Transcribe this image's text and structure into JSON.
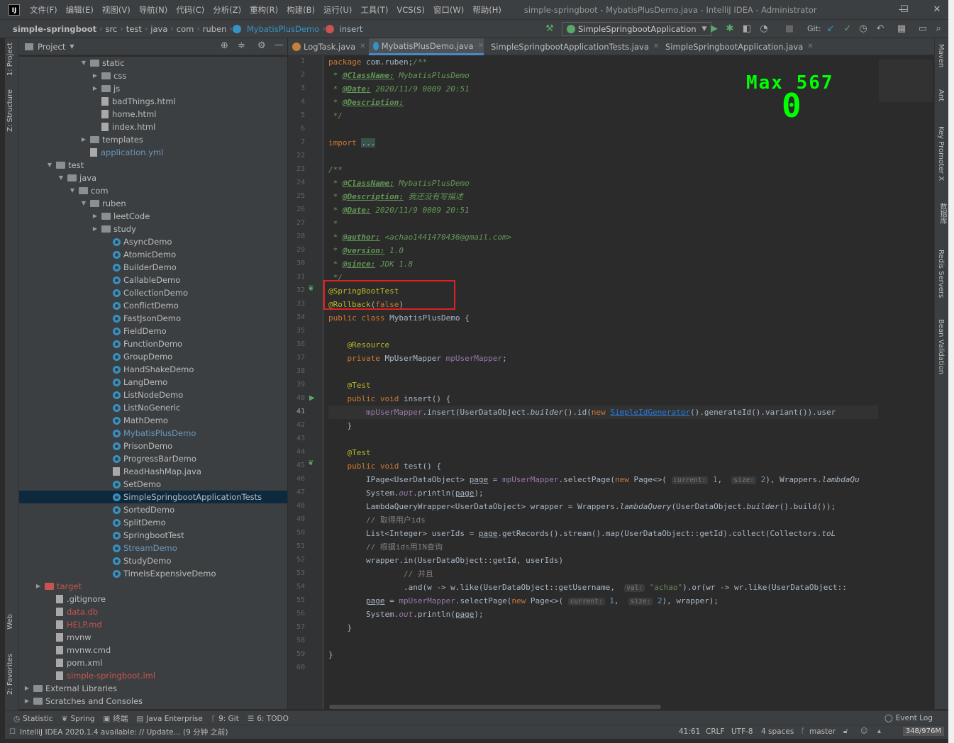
{
  "window": {
    "logo": "IJ",
    "title": "simple-springboot - MybatisPlusDemo.java - IntelliJ IDEA - Administrator",
    "menus": [
      "文件(F)",
      "编辑(E)",
      "视图(V)",
      "导航(N)",
      "代码(C)",
      "分析(Z)",
      "重构(R)",
      "构建(B)",
      "运行(U)",
      "工具(T)",
      "VCS(S)",
      "窗口(W)",
      "帮助(H)"
    ],
    "minimize": "—",
    "maximize": "☐",
    "close": "✕"
  },
  "breadcrumb": [
    "simple-springboot",
    "src",
    "test",
    "java",
    "com",
    "ruben",
    "MybatisPlusDemo",
    "insert"
  ],
  "toolbar": {
    "run_config": "SimpleSpringbootApplication",
    "git_label": "Git:"
  },
  "left_strip": {
    "project": "1: Project",
    "structure": "Z: Structure",
    "web": "Web",
    "favorites": "2: Favorites"
  },
  "right_strip": {
    "maven": "Maven",
    "ant": "Ant",
    "key_promoter": "Key Promoter X",
    "database": "数据库",
    "redis": "Redis Servers",
    "bean": "Bean Validation"
  },
  "project_panel": {
    "title": "Project"
  },
  "tree": [
    {
      "label": "static",
      "indent": 5,
      "type": "folder",
      "open": true
    },
    {
      "label": "css",
      "indent": 6,
      "type": "folder",
      "open": false
    },
    {
      "label": "js",
      "indent": 6,
      "type": "folder",
      "open": false
    },
    {
      "label": "badThings.html",
      "indent": 6,
      "type": "file"
    },
    {
      "label": "home.html",
      "indent": 6,
      "type": "file"
    },
    {
      "label": "index.html",
      "indent": 6,
      "type": "file"
    },
    {
      "label": "templates",
      "indent": 5,
      "type": "folder"
    },
    {
      "label": "application.yml",
      "indent": 5,
      "type": "file",
      "color": "blue"
    },
    {
      "label": "test",
      "indent": 2,
      "type": "folder",
      "open": true
    },
    {
      "label": "java",
      "indent": 3,
      "type": "folder",
      "open": true
    },
    {
      "label": "com",
      "indent": 4,
      "type": "folder",
      "open": true
    },
    {
      "label": "ruben",
      "indent": 5,
      "type": "folder",
      "open": true
    },
    {
      "label": "leetCode",
      "indent": 6,
      "type": "folder",
      "open": false
    },
    {
      "label": "study",
      "indent": 6,
      "type": "folder",
      "open": false
    },
    {
      "label": "AsyncDemo",
      "indent": 7,
      "type": "class"
    },
    {
      "label": "AtomicDemo",
      "indent": 7,
      "type": "class"
    },
    {
      "label": "BuilderDemo",
      "indent": 7,
      "type": "class"
    },
    {
      "label": "CallableDemo",
      "indent": 7,
      "type": "class"
    },
    {
      "label": "CollectionDemo",
      "indent": 7,
      "type": "class"
    },
    {
      "label": "ConflictDemo",
      "indent": 7,
      "type": "class"
    },
    {
      "label": "FastJsonDemo",
      "indent": 7,
      "type": "class"
    },
    {
      "label": "FieldDemo",
      "indent": 7,
      "type": "class"
    },
    {
      "label": "FunctionDemo",
      "indent": 7,
      "type": "class"
    },
    {
      "label": "GroupDemo",
      "indent": 7,
      "type": "class"
    },
    {
      "label": "HandShakeDemo",
      "indent": 7,
      "type": "class"
    },
    {
      "label": "LangDemo",
      "indent": 7,
      "type": "class"
    },
    {
      "label": "ListNodeDemo",
      "indent": 7,
      "type": "class"
    },
    {
      "label": "ListNoGeneric",
      "indent": 7,
      "type": "class"
    },
    {
      "label": "MathDemo",
      "indent": 7,
      "type": "class"
    },
    {
      "label": "MybatisPlusDemo",
      "indent": 7,
      "type": "class",
      "color": "blue"
    },
    {
      "label": "PrisonDemo",
      "indent": 7,
      "type": "class"
    },
    {
      "label": "ProgressBarDemo",
      "indent": 7,
      "type": "class"
    },
    {
      "label": "ReadHashMap.java",
      "indent": 7,
      "type": "file"
    },
    {
      "label": "SetDemo",
      "indent": 7,
      "type": "class"
    },
    {
      "label": "SimpleSpringbootApplicationTests",
      "indent": 7,
      "type": "class",
      "selected": true
    },
    {
      "label": "SortedDemo",
      "indent": 7,
      "type": "class"
    },
    {
      "label": "SplitDemo",
      "indent": 7,
      "type": "class"
    },
    {
      "label": "SpringbootTest",
      "indent": 7,
      "type": "class"
    },
    {
      "label": "StreamDemo",
      "indent": 7,
      "type": "class",
      "color": "blue"
    },
    {
      "label": "StudyDemo",
      "indent": 7,
      "type": "class"
    },
    {
      "label": "TimeIsExpensiveDemo",
      "indent": 7,
      "type": "class"
    },
    {
      "label": "target",
      "indent": 1,
      "type": "folder",
      "open": false,
      "color": "red"
    },
    {
      "label": ".gitignore",
      "indent": 2,
      "type": "file"
    },
    {
      "label": "data.db",
      "indent": 2,
      "type": "file",
      "color": "red"
    },
    {
      "label": "HELP.md",
      "indent": 2,
      "type": "file",
      "color": "red"
    },
    {
      "label": "mvnw",
      "indent": 2,
      "type": "file"
    },
    {
      "label": "mvnw.cmd",
      "indent": 2,
      "type": "file"
    },
    {
      "label": "pom.xml",
      "indent": 2,
      "type": "file"
    },
    {
      "label": "simple-springboot.iml",
      "indent": 2,
      "type": "file",
      "color": "red"
    },
    {
      "label": "External Libraries",
      "indent": 0,
      "type": "folder",
      "open": false
    },
    {
      "label": "Scratches and Consoles",
      "indent": 0,
      "type": "folder",
      "open": false
    }
  ],
  "tabs": [
    {
      "label": "LogTask.java",
      "active": false
    },
    {
      "label": "MybatisPlusDemo.java",
      "active": true
    },
    {
      "label": "SimpleSpringbootApplicationTests.java",
      "active": false
    },
    {
      "label": "SimpleSpringbootApplication.java",
      "active": false
    }
  ],
  "line_numbers": [
    "1",
    "2",
    "3",
    "4",
    "5",
    "6",
    "7",
    "22",
    "23",
    "24",
    "25",
    "26",
    "27",
    "28",
    "29",
    "30",
    "31",
    "32",
    "33",
    "34",
    "35",
    "36",
    "37",
    "38",
    "39",
    "40",
    "41",
    "42",
    "43",
    "44",
    "45",
    "46",
    "47",
    "48",
    "49",
    "50",
    "51",
    "52",
    "53",
    "54",
    "55",
    "56",
    "57",
    "58",
    "59",
    "60"
  ],
  "overlay": {
    "max_label": "Max 567",
    "counter": "0"
  },
  "bottom_tools": [
    {
      "icon": "◷",
      "label": "Statistic"
    },
    {
      "icon": "❦",
      "label": "Spring"
    },
    {
      "icon": "▣",
      "label": "终端"
    },
    {
      "icon": "▤",
      "label": "Java Enterprise"
    },
    {
      "icon": "ᚴ",
      "label": "9: Git"
    },
    {
      "icon": "☰",
      "label": "6: TODO"
    }
  ],
  "event_log": "Event Log",
  "status": {
    "message": "IntelliJ IDEA 2020.1.4 available: // Update... (9 分钟 之前)",
    "position": "41:61",
    "line_sep": "CRLF",
    "encoding": "UTF-8",
    "indent": "4 spaces",
    "branch": "master",
    "memory": "348/976M"
  }
}
